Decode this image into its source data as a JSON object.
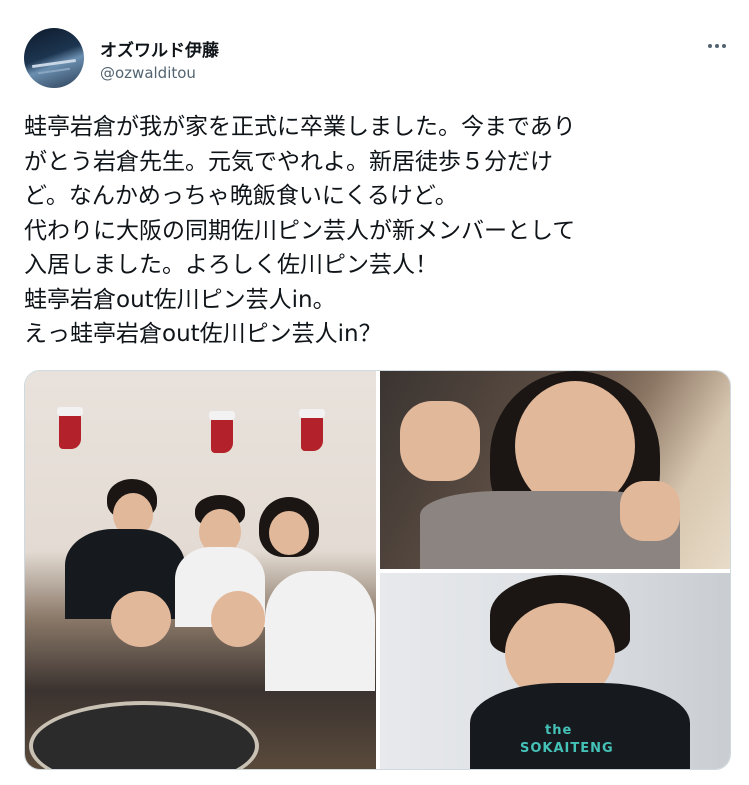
{
  "author": {
    "display_name": "オズワルド伊藤",
    "handle": "@ozwalditou",
    "avatar_icon": "avatar-photo"
  },
  "tweet": {
    "lines": [
      "蛙亭岩倉が我が家を正式に卒業しました。今まであり",
      "がとう岩倉先生。元気でやれよ。新居徒歩５分だけ",
      "ど。なんかめっちゃ晩飯食いにくるけど。",
      "代わりに大阪の同期佐川ピン芸人が新メンバーとして",
      "入居しました。よろしく佐川ピン芸人！",
      "蛙亭岩倉out佐川ピン芸人in。",
      "えっ蛙亭岩倉out佐川ピン芸人in？"
    ]
  },
  "media": {
    "photos": [
      {
        "name": "group-dinner-photo"
      },
      {
        "name": "woman-peace-sign-photo"
      },
      {
        "name": "man-bowl-cut-photo",
        "shirt_text": [
          "the",
          "SOKAITENG"
        ]
      }
    ]
  },
  "colors": {
    "text": "#0f1419",
    "secondary": "#536471",
    "border": "#cfd9de"
  }
}
